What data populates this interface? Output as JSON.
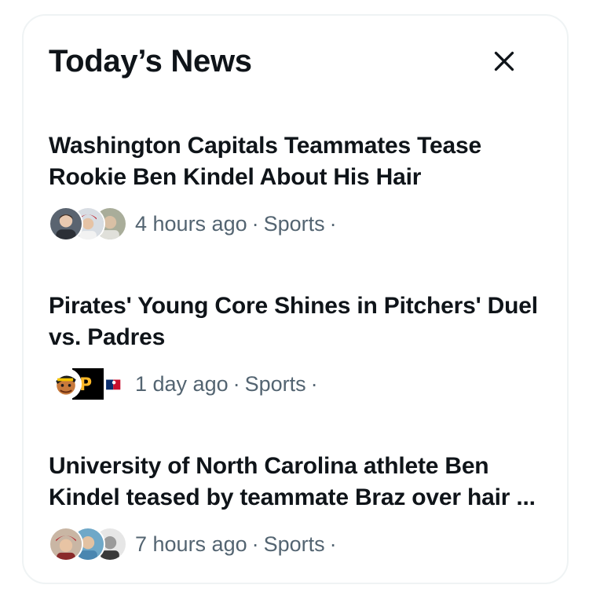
{
  "panel": {
    "title": "Today’s News",
    "close_icon": "close-icon"
  },
  "news": [
    {
      "headline": "Washington Capitals Teammates Tease Rookie Ben Kindel About His Hair",
      "time": "4 hours ago",
      "category": "Sports",
      "separator": "·"
    },
    {
      "headline": "Pirates' Young Core Shines in Pitchers' Duel vs. Padres",
      "time": "1 day ago",
      "category": "Sports",
      "separator": "·"
    },
    {
      "headline": "University of North Carolina athlete Ben Kindel teased by teammate Braz over hair ...",
      "time": "7 hours ago",
      "category": "Sports",
      "separator": "·"
    }
  ],
  "colors": {
    "text_primary": "#0f1419",
    "text_secondary": "#536471",
    "border": "#eff3f4"
  }
}
